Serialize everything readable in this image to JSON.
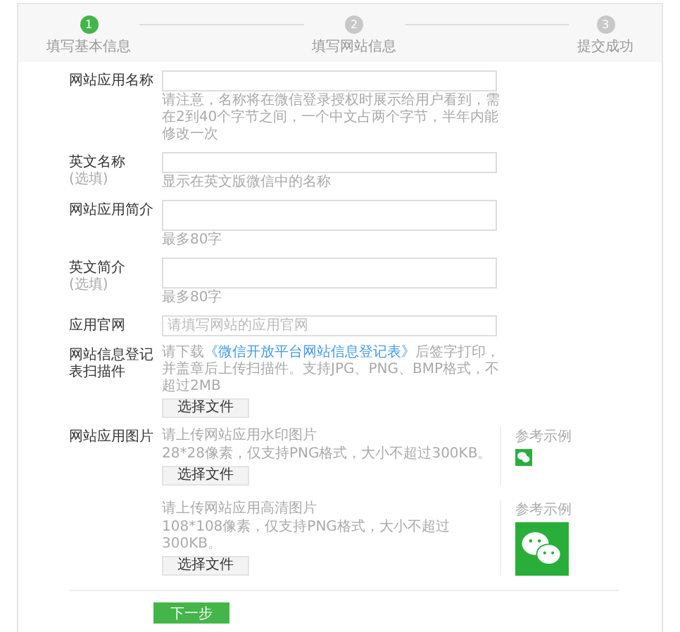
{
  "steps": [
    {
      "number": "1",
      "label": "填写基本信息",
      "selected": true
    },
    {
      "number": "2",
      "label": "填写网站信息",
      "selected": false
    },
    {
      "number": "3",
      "label": "提交成功",
      "selected": false
    }
  ],
  "fields": [
    {
      "kind": "input",
      "label": "网站应用名称",
      "hint": "请注意，名称将在微信登录授权时展示给用户看到，需在2到40个字节之间，一个中文占两个字节，半年内能修改一次"
    },
    {
      "kind": "input",
      "label": "英文名称",
      "optional": "(选填)",
      "hint": "显示在英文版微信中的名称"
    },
    {
      "kind": "textarea",
      "label": "网站应用简介",
      "hint": "最多80字"
    },
    {
      "kind": "textarea",
      "label": "英文简介",
      "optional": "(选填)",
      "hint": "最多80字"
    },
    {
      "kind": "input",
      "label": "应用官网",
      "placeholder": "请填写网站的应用官网"
    },
    {
      "kind": "upload",
      "label": "网站信息登记表扫描件",
      "lead": "请下载",
      "link": "《微信开放平台网站信息登记表》",
      "hint": "后签字打印，并盖章后上传扫描件。支持JPG、PNG、BMP格式，不超过2MB",
      "button": "选择文件"
    }
  ],
  "images": {
    "label": "网站应用图片",
    "items": [
      {
        "kind": "small",
        "title": "请上传网站应用水印图片",
        "hint": "28*28像素，仅支持PNG格式，大小不超过300KB。",
        "button": "选择文件",
        "example": "参考示例"
      },
      {
        "kind": "large",
        "title": "请上传网站应用高清图片",
        "hint": "108*108像素，仅支持PNG格式，大小不超过300KB。",
        "button": "选择文件",
        "example": "参考示例"
      }
    ]
  },
  "next_button": "下一步"
}
